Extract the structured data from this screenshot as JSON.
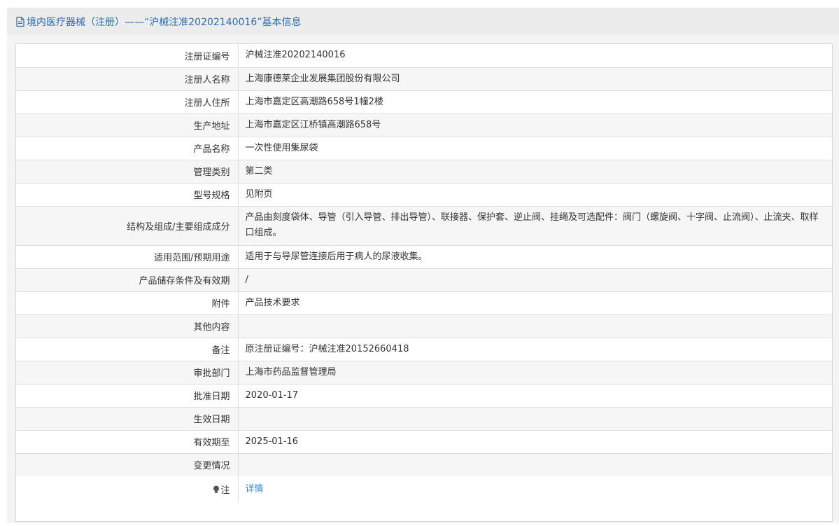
{
  "header": {
    "title": "境内医疗器械（注册）——“沪械注准20202140016”基本信息",
    "icon": "document-icon"
  },
  "rows": [
    {
      "label": "注册证编号",
      "value": "沪械注准20202140016"
    },
    {
      "label": "注册人名称",
      "value": "上海康德莱企业发展集团股份有限公司"
    },
    {
      "label": "注册人住所",
      "value": "上海市嘉定区高潮路658号1幢2楼"
    },
    {
      "label": "生产地址",
      "value": "上海市嘉定区江桥镇高潮路658号"
    },
    {
      "label": "产品名称",
      "value": "一次性使用集尿袋"
    },
    {
      "label": "管理类别",
      "value": "第二类"
    },
    {
      "label": "型号规格",
      "value": "见附页"
    },
    {
      "label": "结构及组成/主要组成成分",
      "value": "产品由刻度袋体、导管（引入导管、排出导管）、联接器、保护套、逆止阀、挂绳及可选配件：阀门（螺旋阀、十字阀、止流阀）、止流夹、取样口组成。"
    },
    {
      "label": "适用范围/预期用途",
      "value": "适用于与导尿管连接后用于病人的尿液收集。"
    },
    {
      "label": "产品储存条件及有效期",
      "value": "/"
    },
    {
      "label": "附件",
      "value": "产品技术要求"
    },
    {
      "label": "其他内容",
      "value": ""
    },
    {
      "label": "备注",
      "value": "原注册证编号：沪械注准20152660418"
    },
    {
      "label": "审批部门",
      "value": "上海市药品监督管理局"
    },
    {
      "label": "批准日期",
      "value": "2020-01-17"
    },
    {
      "label": "生效日期",
      "value": ""
    },
    {
      "label": "有效期至",
      "value": "2025-01-16"
    },
    {
      "label": "变更情况",
      "value": ""
    }
  ],
  "note": {
    "label": "注",
    "icon": "lightbulb-icon",
    "link_text": "详情"
  }
}
